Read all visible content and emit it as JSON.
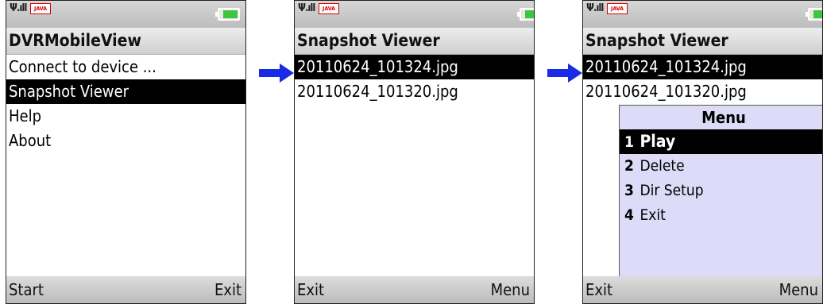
{
  "colors": {
    "arrow": "#1a2be8",
    "selection": "#000000",
    "menu_bg": "#dcdcf8"
  },
  "screens": [
    {
      "status": {
        "signal": "Ψ.ıll",
        "java_badge": "JAVA"
      },
      "title": "DVRMobileView",
      "items": [
        "Connect to device ...",
        "Snapshot Viewer",
        "Help",
        "About"
      ],
      "selected_index": 1,
      "softkeys": {
        "left": "Start",
        "right": "Exit"
      }
    },
    {
      "status": {
        "signal": "Ψ.ıll",
        "java_badge": "JAVA"
      },
      "title": "Snapshot Viewer",
      "items": [
        "20110624_101324.jpg",
        "20110624_101320.jpg"
      ],
      "selected_index": 0,
      "softkeys": {
        "left": "Exit",
        "right": "Menu"
      }
    },
    {
      "status": {
        "signal": "Ψ.ıll",
        "java_badge": "JAVA"
      },
      "title": "Snapshot Viewer",
      "items": [
        "20110624_101324.jpg",
        "20110624_101320.jpg"
      ],
      "selected_index": 0,
      "menu": {
        "title": "Menu",
        "items": [
          {
            "num": "1",
            "label": "Play"
          },
          {
            "num": "2",
            "label": "Delete"
          },
          {
            "num": "3",
            "label": "Dir Setup"
          },
          {
            "num": "4",
            "label": "Exit"
          }
        ],
        "selected_index": 0
      },
      "softkeys": {
        "left": "Exit",
        "right": "Menu"
      }
    }
  ]
}
